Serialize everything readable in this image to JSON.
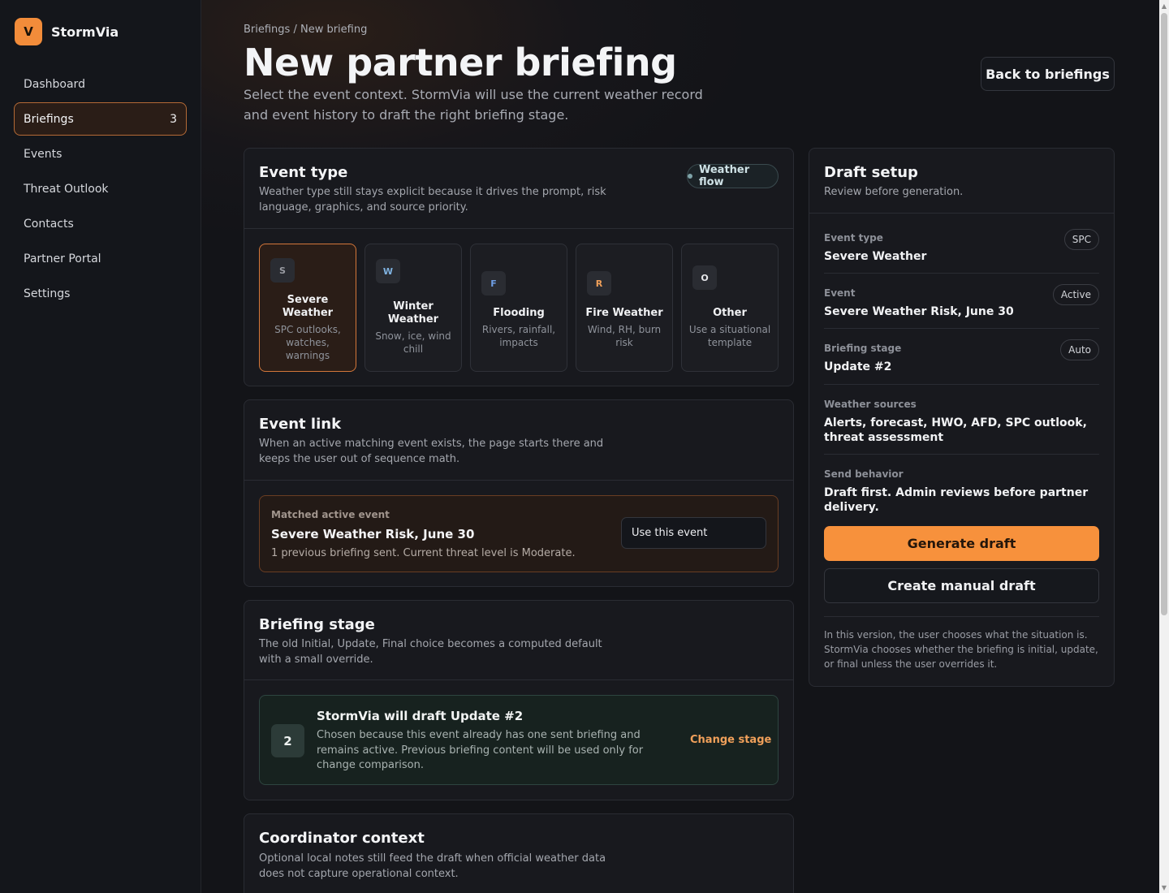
{
  "brand": {
    "logo_letter": "V",
    "name": "StormVia",
    "accent": "#f28c3a"
  },
  "nav": {
    "items": [
      {
        "label": "Dashboard"
      },
      {
        "label": "Briefings",
        "badge": "3"
      },
      {
        "label": "Events"
      },
      {
        "label": "Threat Outlook"
      },
      {
        "label": "Contacts"
      },
      {
        "label": "Partner Portal"
      },
      {
        "label": "Settings"
      }
    ]
  },
  "header": {
    "breadcrumb": "Briefings / New briefing",
    "title": "New partner briefing",
    "subtitle": "Select the event context. StormVia will use the current weather record and event history to draft the right briefing stage.",
    "back_button": "Back to briefings"
  },
  "event_type": {
    "title": "Event type",
    "description": "Weather type still stays explicit because it drives the prompt, risk language, graphics, and source priority.",
    "pill": "Weather flow",
    "options": [
      {
        "letter": "S",
        "name": "Severe Weather",
        "desc": "SPC outlooks, watches, warnings",
        "letter_color": "#9a9ca3"
      },
      {
        "letter": "W",
        "name": "Winter Weather",
        "desc": "Snow, ice, wind chill",
        "letter_color": "#7fb2e0"
      },
      {
        "letter": "F",
        "name": "Flooding",
        "desc": "Rivers, rainfall, impacts",
        "letter_color": "#6f9fe6"
      },
      {
        "letter": "R",
        "name": "Fire Weather",
        "desc": "Wind, RH, burn risk",
        "letter_color": "#f0a05a"
      },
      {
        "letter": "O",
        "name": "Other",
        "desc": "Use a situational template",
        "letter_color": "#e6e7ea"
      }
    ]
  },
  "event_link": {
    "title": "Event link",
    "description": "When an active matching event exists, the page starts there and keeps the user out of sequence math.",
    "match_label": "Matched active event",
    "match_title": "Severe Weather Risk, June 30",
    "match_desc": "1 previous briefing sent. Current threat level is Moderate.",
    "use_button": "Use this event"
  },
  "briefing_stage": {
    "title": "Briefing stage",
    "description": "The old Initial, Update, Final choice becomes a computed default with a small override.",
    "stage_number": "2",
    "stage_title": "StormVia will draft Update #2",
    "stage_desc": "Chosen because this event already has one sent briefing and remains active. Previous briefing content will be used only for change comparison.",
    "change_link": "Change stage"
  },
  "coordinator": {
    "title": "Coordinator context",
    "description": "Optional local notes still feed the draft when official weather data does not capture operational context."
  },
  "draft_setup": {
    "title": "Draft setup",
    "subtitle": "Review before generation.",
    "rows": [
      {
        "label": "Event type",
        "value": "Severe Weather",
        "tag": "SPC"
      },
      {
        "label": "Event",
        "value": "Severe Weather Risk, June 30",
        "tag": "Active"
      },
      {
        "label": "Briefing stage",
        "value": "Update #2",
        "tag": "Auto"
      },
      {
        "label": "Weather sources",
        "value": "Alerts, forecast, HWO, AFD, SPC outlook, threat assessment"
      },
      {
        "label": "Send behavior",
        "value": "Draft first. Admin reviews before partner delivery."
      }
    ],
    "generate_button": "Generate draft",
    "manual_button": "Create manual draft",
    "note": "In this version, the user chooses what the situation is. StormVia chooses whether the briefing is initial, update, or final unless the user overrides it."
  }
}
